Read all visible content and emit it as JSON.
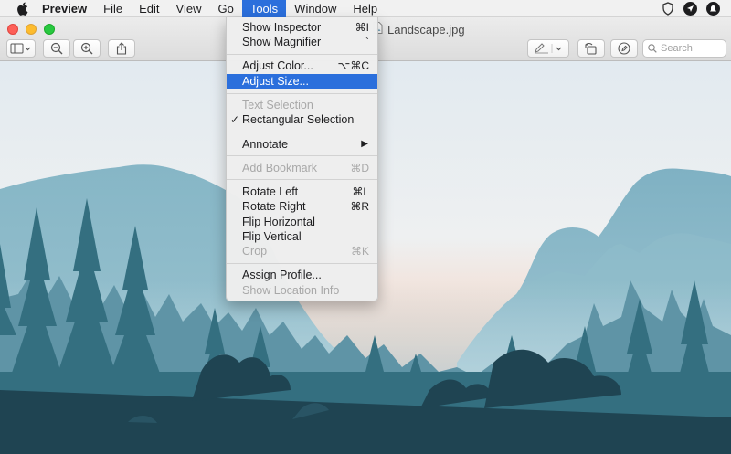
{
  "menubar": {
    "app_name": "Preview",
    "menus": [
      "File",
      "Edit",
      "View",
      "Go",
      "Tools",
      "Window",
      "Help"
    ],
    "active_menu": "Tools"
  },
  "window": {
    "title": "Landscape.jpg"
  },
  "toolbar": {
    "search_placeholder": "Search"
  },
  "tools_menu": {
    "items": [
      {
        "label": "Show Inspector",
        "shortcut": "⌘I",
        "enabled": true
      },
      {
        "label": "Show Magnifier",
        "shortcut": "`",
        "enabled": true
      },
      {
        "label": "Adjust Color...",
        "shortcut": "⌥⌘C",
        "enabled": true
      },
      {
        "label": "Adjust Size...",
        "shortcut": "",
        "enabled": true,
        "highlighted": true
      },
      {
        "label": "Text Selection",
        "shortcut": "",
        "enabled": false
      },
      {
        "label": "Rectangular Selection",
        "shortcut": "",
        "enabled": true,
        "checked": true
      },
      {
        "label": "Annotate",
        "shortcut": "",
        "enabled": true,
        "submenu": true
      },
      {
        "label": "Add Bookmark",
        "shortcut": "⌘D",
        "enabled": false
      },
      {
        "label": "Rotate Left",
        "shortcut": "⌘L",
        "enabled": true
      },
      {
        "label": "Rotate Right",
        "shortcut": "⌘R",
        "enabled": true
      },
      {
        "label": "Flip Horizontal",
        "shortcut": "",
        "enabled": true
      },
      {
        "label": "Flip Vertical",
        "shortcut": "",
        "enabled": true
      },
      {
        "label": "Crop",
        "shortcut": "⌘K",
        "enabled": false
      },
      {
        "label": "Assign Profile...",
        "shortcut": "",
        "enabled": true
      },
      {
        "label": "Show Location Info",
        "shortcut": "",
        "enabled": false
      }
    ],
    "check_mark": "✓",
    "submenu_arrow": "▶"
  },
  "colors": {
    "highlight": "#2b6fdc",
    "sky_top": "#e4ecf1",
    "sunset": "#f3a48c",
    "mountain": "#6fa3b8",
    "forest": "#2c5a6a"
  }
}
